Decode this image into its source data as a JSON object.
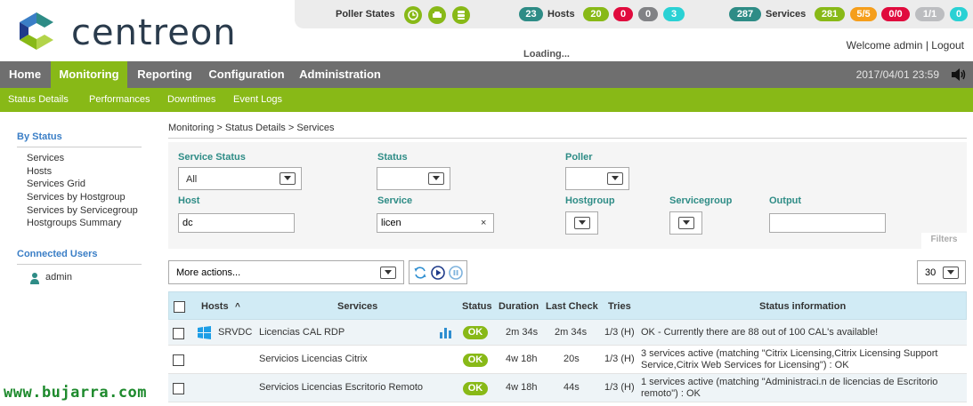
{
  "brand": {
    "name": "centreon"
  },
  "topbar": {
    "poller_label": "Poller States",
    "hosts_label": "Hosts",
    "hosts_total": "23",
    "hosts_up": "20",
    "hosts_down": "0",
    "hosts_unreachable": "0",
    "hosts_pending": "3",
    "services_label": "Services",
    "services_total": "287",
    "services_ok": "281",
    "services_warning": "5/5",
    "services_critical": "0/0",
    "services_unknown": "1/1",
    "services_pending": "0",
    "icons": [
      "clock-icon",
      "car-icon",
      "database-icon"
    ]
  },
  "welcome": {
    "text": "Welcome admin",
    "sep": "|",
    "logout": "Logout"
  },
  "loading": "Loading...",
  "nav": {
    "items": [
      "Home",
      "Monitoring",
      "Reporting",
      "Configuration",
      "Administration"
    ],
    "active": "Monitoring",
    "datetime": "2017/04/01 23:59"
  },
  "subnav": {
    "items": [
      "Status Details",
      "Performances",
      "Downtimes",
      "Event Logs"
    ]
  },
  "sidebar": {
    "by_status_heading": "By Status",
    "by_status_items": [
      "Services",
      "Hosts",
      "Services Grid",
      "Services by Hostgroup",
      "Services by Servicegroup",
      "Hostgroups Summary"
    ],
    "connected_heading": "Connected Users",
    "connected_users": [
      "admin"
    ]
  },
  "breadcrumb": {
    "items": [
      "Monitoring",
      ">",
      "Status Details",
      ">",
      "Services"
    ]
  },
  "filters": {
    "service_status_label": "Service Status",
    "service_status_value": "All",
    "status_label": "Status",
    "status_value": "",
    "poller_label": "Poller",
    "poller_value": "",
    "host_label": "Host",
    "host_value": "dc",
    "service_label": "Service",
    "service_value": "licen",
    "hostgroup_label": "Hostgroup",
    "servicegroup_label": "Servicegroup",
    "output_label": "Output",
    "output_value": "",
    "clear_symbol": "×",
    "filters_tab": "Filters"
  },
  "actions": {
    "more_actions": "More actions...",
    "per_page": "30"
  },
  "table": {
    "headers": {
      "hosts": "Hosts",
      "sort": "^",
      "services": "Services",
      "status": "Status",
      "duration": "Duration",
      "last_check": "Last Check",
      "tries": "Tries",
      "status_information": "Status information"
    },
    "rows": [
      {
        "host": "SRVDC",
        "service": "Licencias CAL RDP",
        "status": "OK",
        "duration": "2m 34s",
        "last_check": "2m 34s",
        "tries": "1/3 (H)",
        "info": "OK - Currently there are 88 out of 100 CAL's available!"
      },
      {
        "host": "",
        "service": "Servicios Licencias Citrix",
        "status": "OK",
        "duration": "4w 18h",
        "last_check": "20s",
        "tries": "1/3 (H)",
        "info": "3 services active (matching \"Citrix Licensing,Citrix Licensing Support Service,Citrix Web Services for Licensing\") : OK"
      },
      {
        "host": "",
        "service": "Servicios Licencias Escritorio Remoto",
        "status": "OK",
        "duration": "4w 18h",
        "last_check": "44s",
        "tries": "1/3 (H)",
        "info": "1 services active (matching \"Administraci.n de licencias de Escritorio remoto\") : OK"
      }
    ]
  },
  "watermark": "www.bujarra.com",
  "colors": {
    "green": "#88b917",
    "teal": "#2e8c86",
    "red": "#e00b3d",
    "grey": "#818285",
    "cyan": "#2ad1d4",
    "orange": "#f59e1b",
    "nav_bg": "#6f6f6f",
    "sidebar_heading": "#3a7ec6"
  }
}
